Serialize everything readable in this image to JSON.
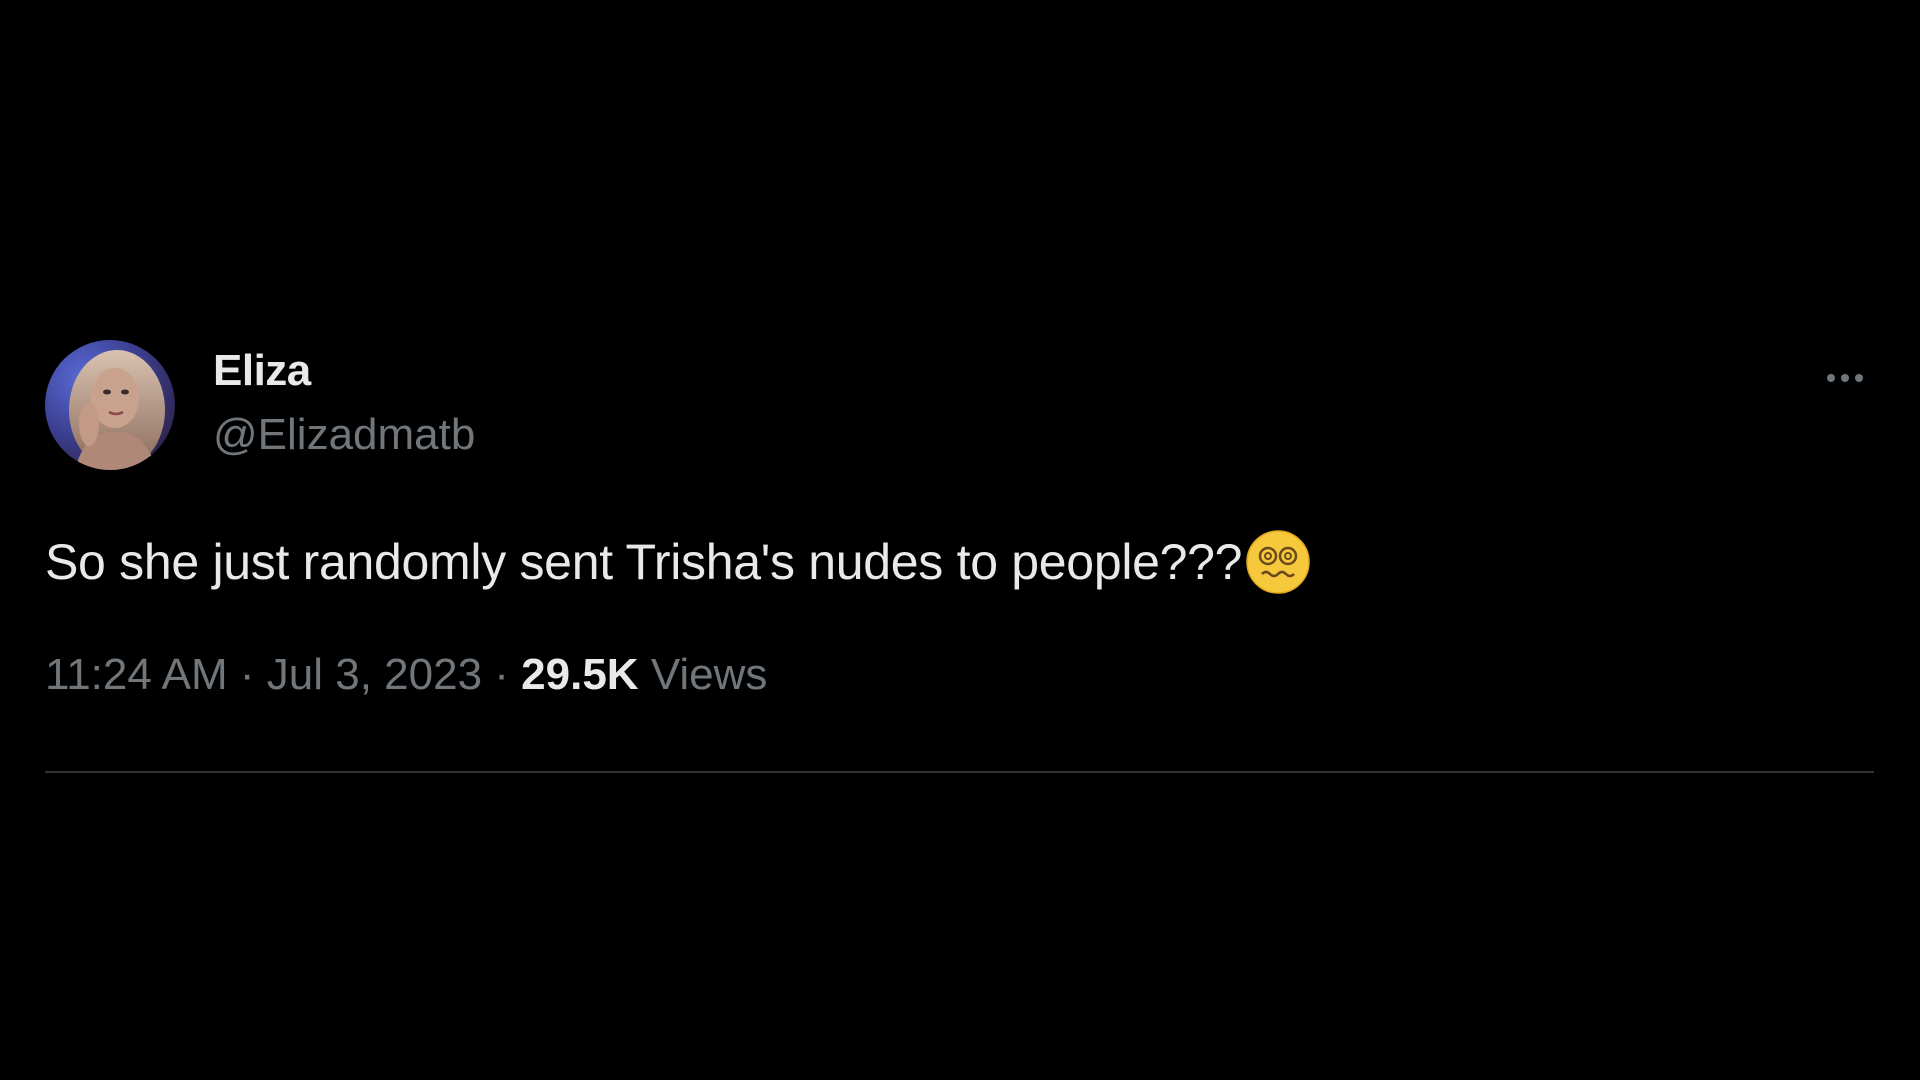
{
  "tweet": {
    "author": {
      "display_name": "Eliza",
      "handle": "@Elizadmatb",
      "avatar_icon": "profile-photo"
    },
    "more_icon": "more-horizontal-icon",
    "text": "So she just randomly sent Trisha's nudes to people???",
    "emoji": "woozy-face-emoji",
    "time": "11:24 AM",
    "separator": "·",
    "date": "Jul 3, 2023",
    "views_count": "29.5K",
    "views_label": "Views"
  },
  "colors": {
    "background": "#000000",
    "primary_text": "#e7e9ea",
    "secondary_text": "#71767b",
    "divider": "#2f3336"
  }
}
